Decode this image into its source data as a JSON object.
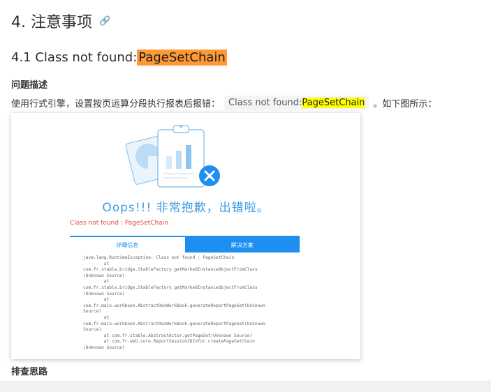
{
  "section": {
    "heading": "4. 注意事项",
    "subheading_prefix": "4.1 Class not found:",
    "subheading_highlight": "PageSetChain"
  },
  "problem": {
    "label": "问题描述",
    "text_before": "使用行式引擎，设置按页运算分段执行报表后报错：",
    "code_prefix": "Class not found:",
    "code_highlight": "PageSetChain",
    "text_after": "。如下图所示："
  },
  "error_page": {
    "oops": "Oops!!! 非常抱歉，出错啦。",
    "error_line": "Class not found : PageSetChain",
    "tabs": [
      "详细信息",
      "解决方案"
    ],
    "stack_trace": "java.lang.RuntimeException: Class not found : PageSetChain\n        at\ncom.fr.stable.bridge.StableFactory.getMarkedInstanceObjectFromClass\n(Unknown Source)\n        at\ncom.fr.stable.bridge.StableFactory.getMarkedInstanceObjectFromClass\n(Unknown Source)\n        at\ncom.fr.main.workbook.AbstractResWorkBook.generateReportPageSet(Unknown\nSource)\n        at\ncom.fr.main.workbook.AbstractResWorkBook.generateReportPageSet(Unknown\nSource)\n        at com.fr.stable.AbstractActor.getPageSet(Unknown Source)\n        at com.fr.web.core.ReportSessionIDInfor.createPageSetChain\n(Unknown Source)"
  },
  "next": {
    "label": "排查思路"
  },
  "colors": {
    "highlight_orange": "#ff9933",
    "highlight_yellow": "#ffff00",
    "accent_blue": "#1e8ff0",
    "error_red": "#e24a4a"
  }
}
